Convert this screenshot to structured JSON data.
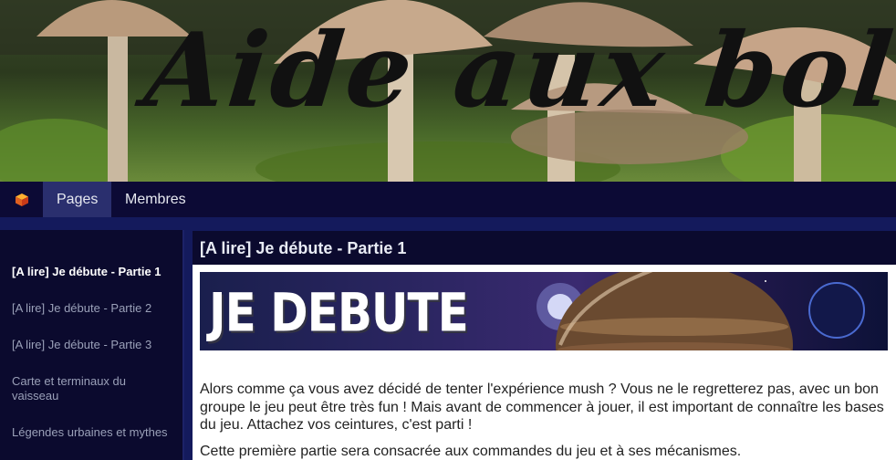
{
  "banner": {
    "title": "Aide aux bolets"
  },
  "nav": {
    "logo_icon": "cube-icon",
    "items": [
      {
        "label": "Pages"
      },
      {
        "label": "Membres"
      }
    ]
  },
  "sidebar": {
    "items": [
      {
        "label": "[A lire] Je débute - Partie 1"
      },
      {
        "label": "[A lire] Je débute - Partie 2"
      },
      {
        "label": "[A lire] Je débute - Partie 3"
      },
      {
        "label": "Carte et terminaux du vaisseau"
      },
      {
        "label": "Légendes urbaines et mythes"
      }
    ]
  },
  "content": {
    "title": "[A lire] Je débute - Partie 1",
    "hero_text": "JE DEBUTE",
    "paragraphs": [
      "Alors comme ça vous avez décidé de tenter l'expérience mush ? Vous ne le regretterez pas, avec un bon groupe le jeu peut être très fun ! Mais avant de commencer à jouer, il est important de connaître les bases du jeu. Attachez vos ceintures, c'est parti !",
      "Cette première partie sera consacrée aux commandes du jeu et à ses mécanismes."
    ]
  },
  "colors": {
    "page_bg": "#141a5c",
    "navbar_bg": "#0c0a35",
    "nav_active_bg": "#2a2f6e",
    "sidebar_bg": "#0b0a2e"
  }
}
